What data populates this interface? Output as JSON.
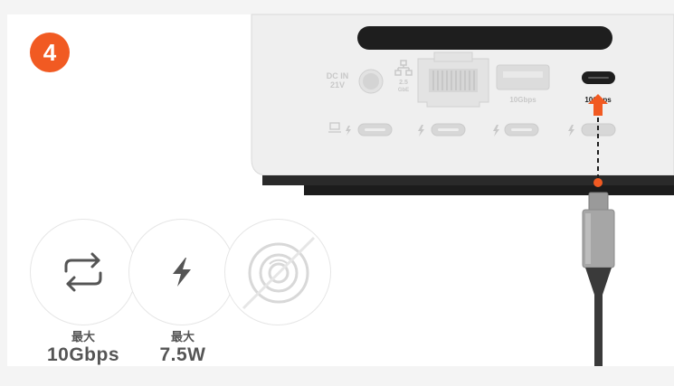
{
  "step": {
    "number": "4"
  },
  "device": {
    "dc_in_label_line1": "DC IN",
    "dc_in_label_line2": "21V",
    "ethernet_speed_line1": "2.5",
    "ethernet_speed_line2": "GbE",
    "usb_a_speed": "10Gbps",
    "usb_c_speed": "10Gbps"
  },
  "specs": [
    {
      "icon": "data-transfer-icon",
      "label": "最大",
      "value": "10Gbps"
    },
    {
      "icon": "power-bolt-icon",
      "label": "最大",
      "value": "7.5W"
    },
    {
      "icon": "no-display-icon",
      "label": "",
      "value": ""
    }
  ],
  "colors": {
    "accent": "#f15a22",
    "device_body": "#efefef",
    "device_dark": "#222222",
    "cable": "#3a3a3a",
    "icon_gray": "#555555"
  }
}
